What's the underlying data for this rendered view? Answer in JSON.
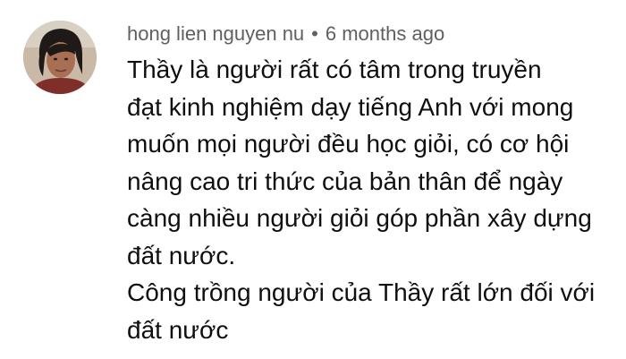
{
  "comment": {
    "author": "hong lien nguyen nu",
    "separator": "•",
    "timestamp": "6 months ago",
    "avatar_icon": "user-avatar-photo",
    "lines": [
      "Thầy là người rất có tâm trong truyền",
      "đạt kinh nghiệm dạy tiếng Anh với mong",
      "muốn mọi người đều học giỏi, có cơ hội",
      "nâng cao tri thức của bản thân để ngày",
      "càng nhiều người giỏi góp phần xây dựng",
      "đất nước.",
      "Công trồng người của Thầy rất lớn đối với",
      "đất nước"
    ]
  }
}
